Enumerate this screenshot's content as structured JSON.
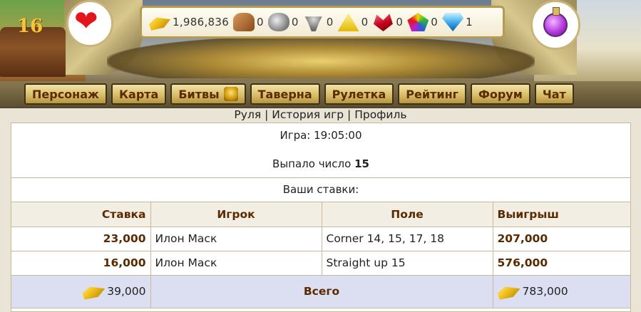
{
  "header": {
    "cake_number": "16",
    "resources": [
      {
        "icon": "gold-bars-icon",
        "value": "1,986,836"
      },
      {
        "icon": "wood-icon",
        "value": "0"
      },
      {
        "icon": "stone-icon",
        "value": "0"
      },
      {
        "icon": "iron-ore-icon",
        "value": "0"
      },
      {
        "icon": "sulfur-icon",
        "value": "0"
      },
      {
        "icon": "crystal-icon",
        "value": "0"
      },
      {
        "icon": "gems-icon",
        "value": "0"
      },
      {
        "icon": "diamond-icon",
        "value": "1"
      }
    ]
  },
  "nav": {
    "tabs": [
      "Персонаж",
      "Карта",
      "Битвы",
      "Таверна",
      "Рулетка",
      "Рейтинг",
      "Форум",
      "Чат"
    ]
  },
  "sublinks": {
    "roulette": "Руля",
    "sep1": " | ",
    "history": "История игр",
    "sep2": " | ",
    "profile": "Профиль"
  },
  "game": {
    "time_line": "Игра: 19:05:00",
    "result_prefix": "Выпало число ",
    "result_number": "15",
    "bets_caption": "Ваши ставки:"
  },
  "table": {
    "headers": {
      "stake": "Ставка",
      "player": "Игрок",
      "field": "Поле",
      "win": "Выигрыш"
    },
    "rows": [
      {
        "stake": "23,000",
        "player": "Илон Маск",
        "field": "Corner 14, 15, 17, 18",
        "win": "207,000"
      },
      {
        "stake": "16,000",
        "player": "Илон Маск",
        "field": "Straight up 15",
        "win": "576,000"
      }
    ],
    "total": {
      "stake": "39,000",
      "label": "Всего",
      "win": "783,000"
    }
  },
  "colors": {
    "tab_text": "#5a2a00",
    "total_row_bg": "#dcdff2",
    "heart": "#e3141c"
  }
}
